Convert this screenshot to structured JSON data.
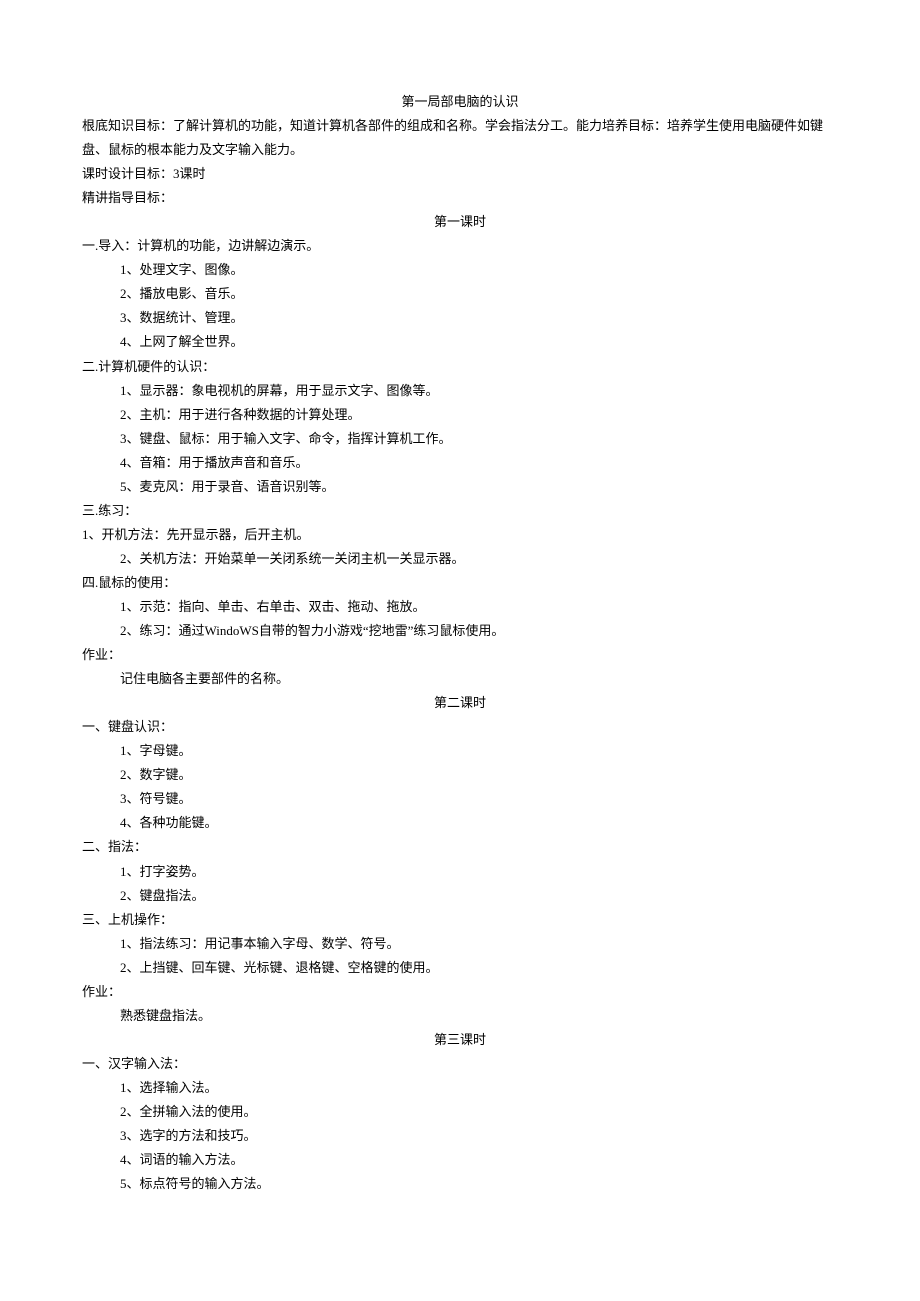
{
  "title_main": "第一局部电脑的认识",
  "intro": [
    "根底知识目标：了解计算机的功能，知道计算机各部件的组成和名称。学会指法分工。能力培养目标：培养学生使用电脑硬件如键盘、鼠标的根本能力及文字输入能力。",
    "课时设计目标：3课时",
    "精讲指导目标："
  ],
  "lesson1": {
    "heading": "第一课时",
    "section1": {
      "head": "一.导入：计算机的功能，边讲解边演示。",
      "items": [
        "1、处理文字、图像。",
        "2、播放电影、音乐。",
        "3、数据统计、管理。",
        "4、上网了解全世界。"
      ]
    },
    "section2": {
      "head": "二.计算机硬件的认识：",
      "items": [
        "1、显示器：象电视机的屏幕，用于显示文字、图像等。",
        "2、主机：用于进行各种数据的计算处理。",
        "3、键盘、鼠标：用于输入文字、命令，指挥计算机工作。",
        "4、音箱：用于播放声音和音乐。",
        "5、麦克风：用于录音、语音识别等。"
      ]
    },
    "section3": {
      "head": "三.练习：",
      "item_top": "1、开机方法：先开显示器，后开主机。",
      "items": [
        "2、关机方法：开始菜单一关闭系统一关闭主机一关显示器。"
      ]
    },
    "section4": {
      "head": "四.鼠标的使用：",
      "items": [
        "1、示范：指向、单击、右单击、双击、拖动、拖放。",
        "2、练习：通过WindoWS自带的智力小游戏“挖地雷”练习鼠标使用。"
      ]
    },
    "homework": {
      "head": "作业：",
      "items": [
        "记住电脑各主要部件的名称。"
      ]
    }
  },
  "lesson2": {
    "heading": "第二课时",
    "section1": {
      "head": "一、键盘认识：",
      "items": [
        "1、字母键。",
        "2、数字键。",
        "3、符号键。",
        "4、各种功能键。"
      ]
    },
    "section2": {
      "head": "二、指法：",
      "items": [
        "1、打字姿势。",
        "2、键盘指法。"
      ]
    },
    "section3": {
      "head": "三、上机操作：",
      "items": [
        "1、指法练习：用记事本输入字母、数学、符号。",
        "2、上挡键、回车键、光标键、退格键、空格键的使用。"
      ]
    },
    "homework": {
      "head": "作业：",
      "items": [
        "熟悉键盘指法。"
      ]
    }
  },
  "lesson3": {
    "heading": "第三课时",
    "section1": {
      "head": "一、汉字输入法：",
      "items": [
        "1、选择输入法。",
        "2、全拼输入法的使用。",
        "3、选字的方法和技巧。",
        "4、词语的输入方法。",
        "5、标点符号的输入方法。"
      ]
    }
  }
}
